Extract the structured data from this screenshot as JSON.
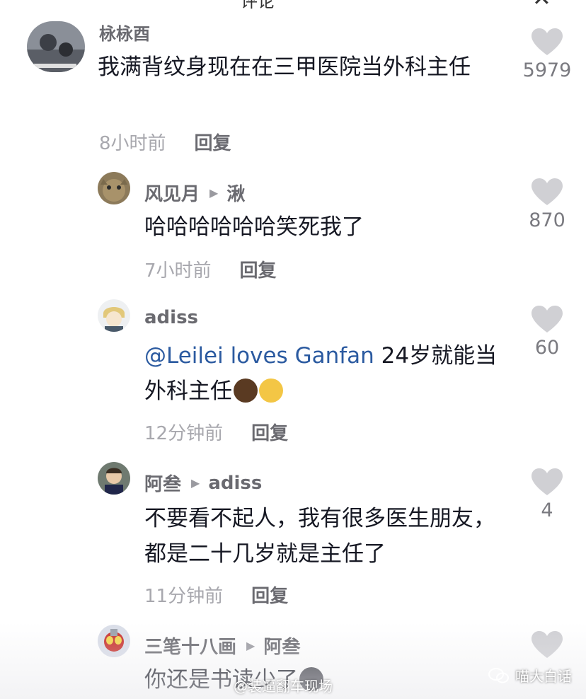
{
  "header": {
    "title": "评论",
    "close_icon": "close-icon"
  },
  "comments": [
    {
      "username": "栐栐酉",
      "reply_to": "",
      "text": "我满背纹身现在在三甲医院当外科主任",
      "time": "8小时前",
      "reply_label": "回复",
      "likes": "5979"
    },
    {
      "username": "风见月",
      "reply_to": "湫",
      "text": "哈哈哈哈哈哈笑死我了",
      "time": "7小时前",
      "reply_label": "回复",
      "likes": "870"
    },
    {
      "username": "adiss",
      "reply_to": "",
      "mention": "@Leilei loves Ganfan",
      "text": " 24岁就能当外科主任",
      "time": "12分钟前",
      "reply_label": "回复",
      "likes": "60"
    },
    {
      "username": "阿叁",
      "reply_to": "adiss",
      "text": "不要看不起人，我有很多医生朋友，都是二十几岁就是主任了",
      "time": "11分钟前",
      "reply_label": "回复",
      "likes": "4"
    },
    {
      "username": "三笔十八画",
      "reply_to": "阿叁",
      "text": "你还是书读少了",
      "time": "",
      "reply_label": "",
      "likes": ""
    }
  ],
  "watermarks": {
    "weibo": "@装逼翻车现场",
    "wechat": "喵大白话"
  },
  "colors": {
    "mention": "#2b5aa0",
    "like_icon": "#d0d0d4",
    "meta": "#a8a8ae"
  }
}
